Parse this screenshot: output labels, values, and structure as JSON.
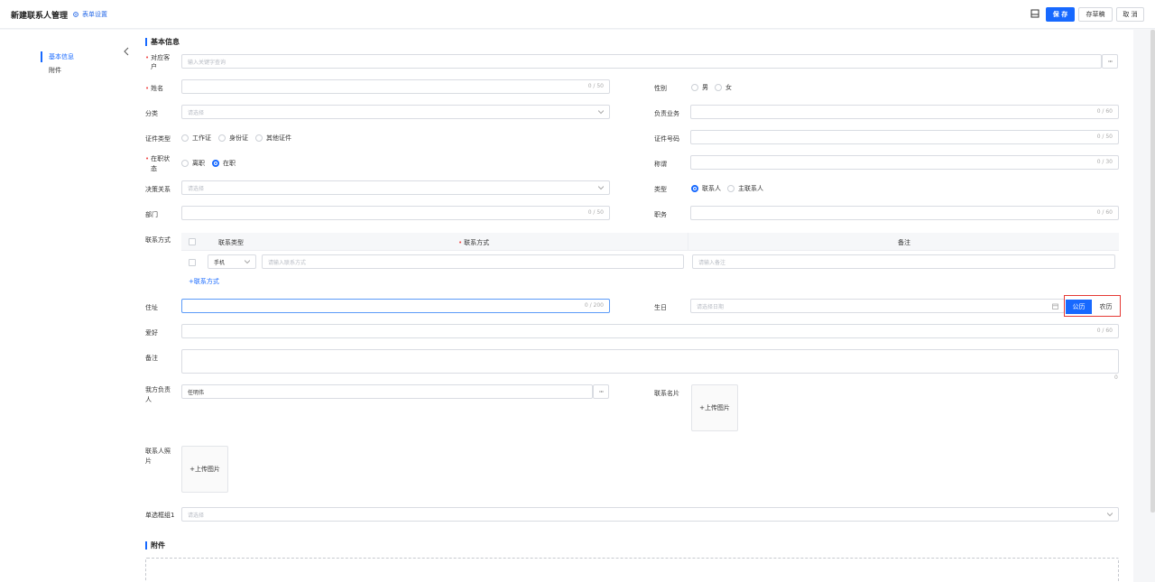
{
  "header": {
    "title": "新建联系人管理",
    "form_settings": "表单设置",
    "buttons": {
      "save": "保 存",
      "draft": "存草稿",
      "cancel": "取 消"
    }
  },
  "sidebar": {
    "items": [
      {
        "label": "基本信息",
        "active": true
      },
      {
        "label": "附件",
        "active": false
      }
    ]
  },
  "sections": {
    "basic": "基本信息",
    "attachment": "附件"
  },
  "fields": {
    "customer": {
      "label_1": "对应客",
      "label_2": "户",
      "placeholder": "输入关键字查询"
    },
    "name": {
      "label": "姓名",
      "counter": "0 / 50"
    },
    "gender": {
      "label": "性别",
      "options": [
        "男",
        "女"
      ]
    },
    "category": {
      "label": "分类",
      "placeholder": "请选择"
    },
    "business": {
      "label": "负责业务",
      "counter": "0 / 60"
    },
    "id_type": {
      "label": "证件类型",
      "options": [
        "工作证",
        "身份证",
        "其他证件"
      ]
    },
    "id_number": {
      "label": "证件号码",
      "counter": "0 / 50"
    },
    "employment": {
      "label_1": "在职状",
      "label_2": "态",
      "options": [
        "离职",
        "在职"
      ],
      "selected": "在职"
    },
    "title": {
      "label": "称谓",
      "counter": "0 / 30"
    },
    "decision": {
      "label": "决策关系",
      "placeholder": "请选择"
    },
    "type": {
      "label": "类型",
      "options": [
        "联系人",
        "主联系人"
      ],
      "selected": "联系人"
    },
    "department": {
      "label": "部门",
      "counter": "0 / 50"
    },
    "position": {
      "label": "职务",
      "counter": "0 / 60"
    },
    "contact_methods": {
      "label": "联系方式",
      "columns": [
        "联系类型",
        "联系方式",
        "备注"
      ],
      "row": {
        "type": "手机",
        "method_placeholder": "请输入联系方式",
        "note_placeholder": "请输入备注"
      },
      "add_link": "联系方式"
    },
    "address": {
      "label": "住址",
      "counter": "0 / 200"
    },
    "birthday": {
      "label": "生日",
      "placeholder": "请选择日期",
      "toggle": [
        "公历",
        "农历"
      ],
      "selected": "公历"
    },
    "hobby": {
      "label": "爱好",
      "counter": "0 / 60"
    },
    "remark": {
      "label": "备注",
      "counter": "0"
    },
    "owner": {
      "label_1": "我方负责",
      "label_2": "人",
      "value": "任明伟"
    },
    "card": {
      "label": "联系名片",
      "upload": "上传图片"
    },
    "photo": {
      "label_1": "联系人照",
      "label_2": "片",
      "upload": "上传图片"
    },
    "radio_group": {
      "label": "单选框组1",
      "placeholder": "请选择"
    }
  },
  "colors": {
    "primary": "#1769ff",
    "required": "#f04848",
    "highlight": "#e53935"
  }
}
